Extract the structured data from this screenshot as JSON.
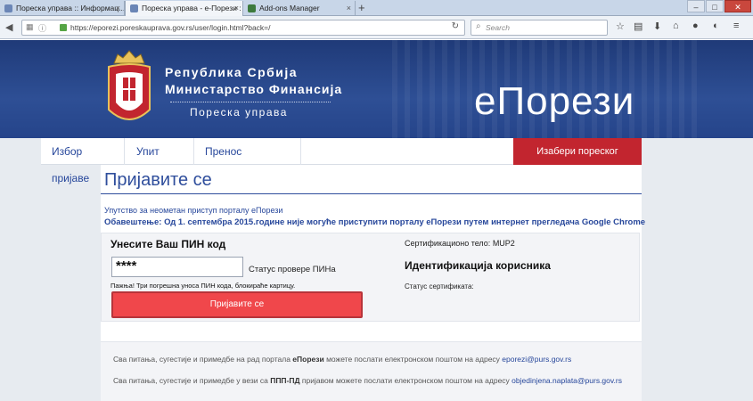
{
  "browser": {
    "tabs": [
      {
        "label": "Пореска управа :: Информац..."
      },
      {
        "label": "Пореска управа - е-Порези : ..."
      },
      {
        "label": "Add-ons Manager"
      }
    ],
    "url": "https://eporezi.poreskauprava.gov.rs/user/login.html?back=/",
    "search_placeholder": "Search"
  },
  "header": {
    "line1": "Република Србија",
    "line2": "Министарство Финансија",
    "line3": "Пореска управа",
    "brand": "еПорези"
  },
  "menu": {
    "items": [
      "Избор пријаве",
      "Упит стања",
      "Пренос овлашћења"
    ],
    "highlight": "Изабери пореског обвезника"
  },
  "login": {
    "title": "Пријавите се",
    "help_link": "Упутство за неометан приступ порталу еПорези",
    "notice": "Обавештење: Од 1. септембра 2015.године није могуће приступити порталу еПорези путем интернет прегледача Google Chrome",
    "pin_label": "Унесите Ваш ПИН код",
    "pin_value": "****",
    "pin_status": "Статус провере ПИНа",
    "warning": "Пажња! Три погрешна уноса ПИН кода, блокираће картицу.",
    "button": "Пријавите се",
    "cert_body_label": "Сертификационо тело:",
    "cert_body_value": "MUP2",
    "id_title": "Идентификација корисника",
    "cert_status": "Статус сертификата:"
  },
  "footer": {
    "row1_pre": "Сва питања, сугестије и примедбе на рад портала ",
    "row1_bold": "еПорези",
    "row1_post": " можете послати електронском поштом на адресу ",
    "row1_email": "eporezi@purs.gov.rs",
    "row2_pre": "Сва питања, сугестије и примедбе у вези са ",
    "row2_bold": "ППП-ПД",
    "row2_post": " пријавом можете послати електронском поштом на адресу ",
    "row2_email": "objedinjena.naplata@purs.gov.rs"
  },
  "colors": {
    "header_blue": "#2e4f95",
    "accent_red": "#c2252f",
    "button_red": "#f0474b",
    "link_blue": "#27479b"
  }
}
